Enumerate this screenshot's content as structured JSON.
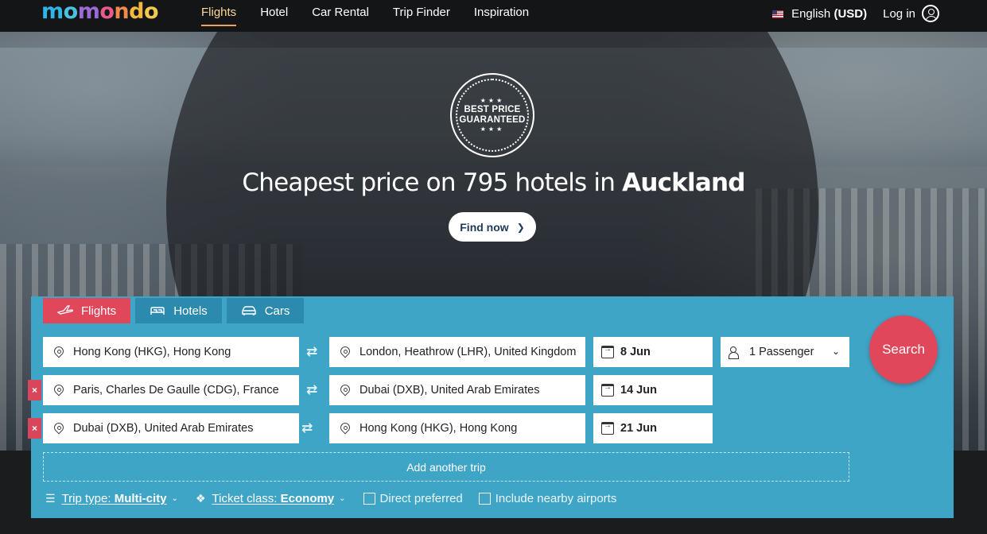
{
  "brand": {
    "logo": "momondo",
    "logo_colors": [
      "#2fb5e6",
      "#4bc0e0",
      "#9b6ad6",
      "#e75a8b",
      "#f08a4b",
      "#f2b93b",
      "#f2c94c"
    ]
  },
  "nav": {
    "items": [
      {
        "label": "Flights",
        "active": true
      },
      {
        "label": "Hotel",
        "active": false
      },
      {
        "label": "Car Rental",
        "active": false
      },
      {
        "label": "Trip Finder",
        "active": false
      },
      {
        "label": "Inspiration",
        "active": false
      }
    ],
    "language": "English",
    "currency": "(USD)",
    "login": "Log in"
  },
  "hero": {
    "badge_line1": "BEST PRICE",
    "badge_line2": "GUARANTEED",
    "badge_stars": "★★★",
    "headline_pre": "Cheapest price on 795 hotels in ",
    "headline_city": "Auckland",
    "cta": "Find now",
    "cta_icon": "chevron-right-icon"
  },
  "search": {
    "tabs": [
      {
        "label": "Flights",
        "icon": "plane-icon",
        "active": true
      },
      {
        "label": "Hotels",
        "icon": "bed-icon",
        "active": false
      },
      {
        "label": "Cars",
        "icon": "car-icon",
        "active": false
      }
    ],
    "trips": [
      {
        "from": "Hong Kong (HKG), Hong Kong",
        "to": "London, Heathrow (LHR), United Kingdom",
        "date": "8 Jun",
        "removable": false
      },
      {
        "from": "Paris, Charles De Gaulle (CDG), France",
        "to": "Dubai (DXB), United Arab Emirates",
        "date": "14 Jun",
        "removable": true
      },
      {
        "from": "Dubai (DXB), United Arab Emirates",
        "to": "Hong Kong (HKG), Hong Kong",
        "date": "21 Jun",
        "removable": true
      }
    ],
    "remove_symbol": "×",
    "swap_symbol": "⇄",
    "passengers": "1 Passenger",
    "search_button": "Search",
    "add_trip": "Add another trip",
    "trip_type_label": "Trip type:",
    "trip_type_value": "Multi-city",
    "ticket_class_label": "Ticket class:",
    "ticket_class_value": "Economy",
    "direct_preferred": "Direct preferred",
    "nearby_airports": "Include nearby airports",
    "accent_color": "#e0475b",
    "panel_color": "#3fa5c7"
  }
}
